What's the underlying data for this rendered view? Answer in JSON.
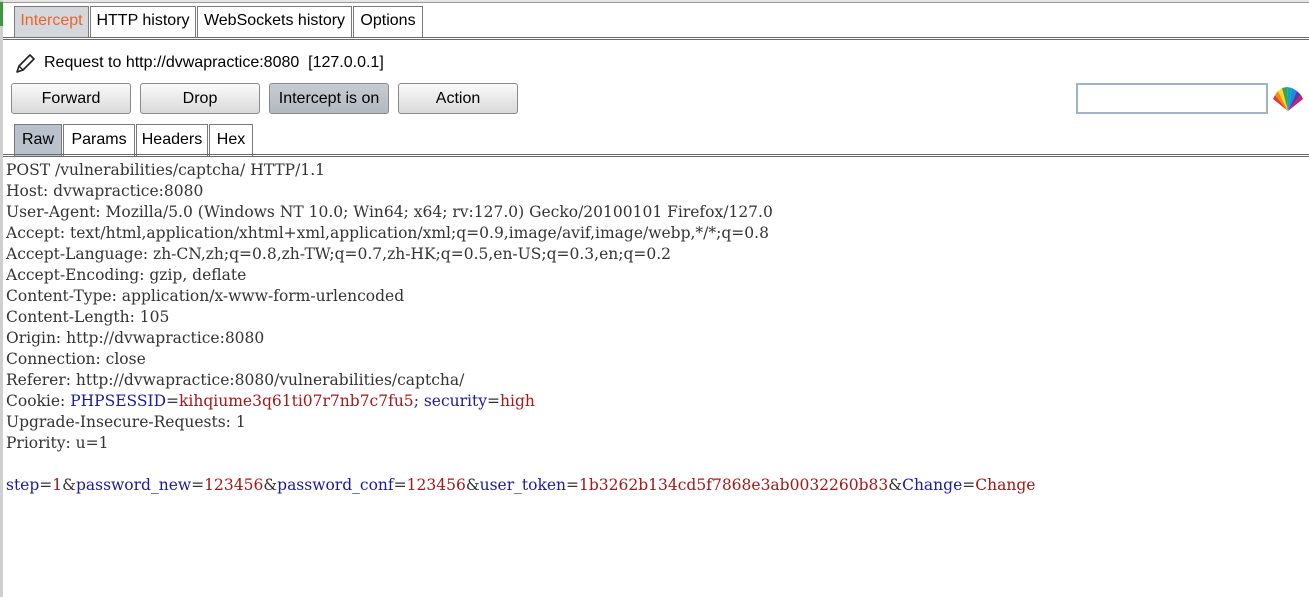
{
  "tabs": [
    {
      "label": "Intercept",
      "active": true
    },
    {
      "label": "HTTP history",
      "active": false
    },
    {
      "label": "WebSockets history",
      "active": false
    },
    {
      "label": "Options",
      "active": false
    }
  ],
  "request_label": "Request to http://dvwapractice:8080  [127.0.0.1]",
  "buttons": {
    "forward": "Forward",
    "drop": "Drop",
    "intercept": "Intercept is on",
    "action": "Action"
  },
  "search": {
    "value": ""
  },
  "view_tabs": [
    {
      "label": "Raw",
      "active": true
    },
    {
      "label": "Params",
      "active": false
    },
    {
      "label": "Headers",
      "active": false
    },
    {
      "label": "Hex",
      "active": false
    }
  ],
  "request_lines": [
    "POST /vulnerabilities/captcha/ HTTP/1.1",
    "Host: dvwapractice:8080",
    "User-Agent: Mozilla/5.0 (Windows NT 10.0; Win64; x64; rv:127.0) Gecko/20100101 Firefox/127.0",
    "Accept: text/html,application/xhtml+xml,application/xml;q=0.9,image/avif,image/webp,*/*;q=0.8",
    "Accept-Language: zh-CN,zh;q=0.8,zh-TW;q=0.7,zh-HK;q=0.5,en-US;q=0.3,en;q=0.2",
    "Accept-Encoding: gzip, deflate",
    "Content-Type: application/x-www-form-urlencoded",
    "Content-Length: 105",
    "Origin: http://dvwapractice:8080",
    "Connection: close",
    "Referer: http://dvwapractice:8080/vulnerabilities/captcha/"
  ],
  "cookie": {
    "prefix": "Cookie: ",
    "name1": "PHPSESSID",
    "eq": "=",
    "value1": "kihqiume3q61ti07r7nb7c7fu5",
    "sep": "; ",
    "name2": "security",
    "value2": "high"
  },
  "request_lines_after": [
    "Upgrade-Insecure-Requests: 1",
    "Priority: u=1"
  ],
  "body_params": [
    {
      "name": "step",
      "value": "1"
    },
    {
      "name": "password_new",
      "value": "123456"
    },
    {
      "name": "password_conf",
      "value": "123456"
    },
    {
      "name": "user_token",
      "value": "1b3262b134cd5f7868e3ab0032260b83"
    },
    {
      "name": "Change",
      "value": "Change"
    }
  ],
  "colors": {
    "active_tab_text": "#e8642c",
    "param_name": "#1a1a9a",
    "param_value": "#a01818"
  },
  "icons": [
    "pencil-icon",
    "burp-logo-icon"
  ]
}
